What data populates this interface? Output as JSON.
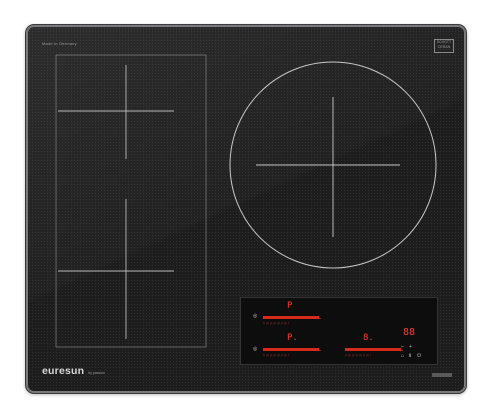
{
  "product": {
    "made_in": "Made in Germany",
    "cert_label": "SCHOTT",
    "cert_sub": "CERAN",
    "brand": "euresun",
    "brand_sub": "by passion"
  },
  "displays": {
    "zone_front_left": "P.",
    "zone_rear_left": "P",
    "zone_front_right": "8.",
    "timer": "88"
  },
  "colors": {
    "glass": "#1d1d1e",
    "frame": "#7a7a7c",
    "zone_lines": "#b9b9b9",
    "display_red": "#ff3b2a"
  }
}
